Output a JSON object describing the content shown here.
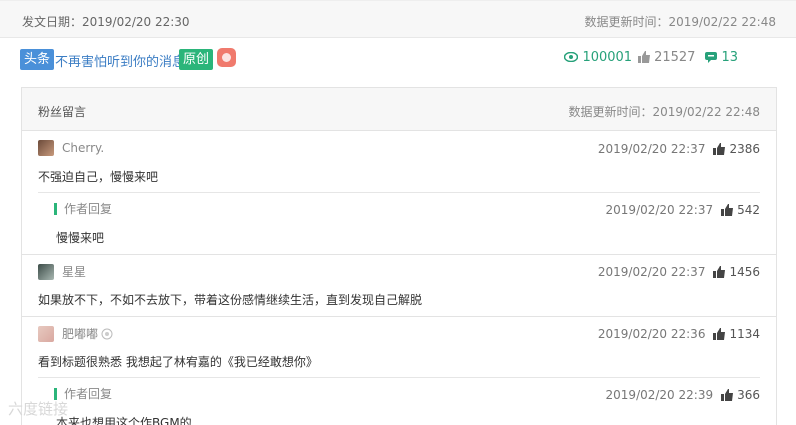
{
  "topbar": {
    "publish": "发文日期：2019/02/20 22:30",
    "update": "数据更新时间：2019/02/22 22:48"
  },
  "article": {
    "tag_head": "头条",
    "title": "不再害怕听到你的消息",
    "tag_original": "原创",
    "views": "100001",
    "likes": "21527",
    "comments": "13"
  },
  "panel": {
    "title": "粉丝留言",
    "update": "数据更新时间：2019/02/22 22:48"
  },
  "comments": [
    {
      "user": "Cherry.",
      "time": "2019/02/20 22:37",
      "likes": "2386",
      "text": "不强迫自己，慢慢来吧"
    },
    {
      "user": "作者回复",
      "time": "2019/02/20 22:37",
      "likes": "542",
      "text": "慢慢来吧"
    },
    {
      "user": "星星",
      "time": "2019/02/20 22:37",
      "likes": "1456",
      "text": "如果放不下，不如不去放下，带着这份感情继续生活，直到发现自己解脱"
    },
    {
      "user": "肥嘟嘟",
      "time": "2019/02/20 22:36",
      "likes": "1134",
      "text": "看到标题很熟悉 我想起了林宥嘉的《我已经敢想你》"
    },
    {
      "user": "作者回复",
      "time": "2019/02/20 22:39",
      "likes": "366",
      "text": "本来也想用这个作BGM的"
    }
  ],
  "watermark": "六度链接",
  "colors": {
    "accent_green": "#2bb57a",
    "link_blue": "#3b7dc4",
    "head_blue": "#4a90d9"
  }
}
